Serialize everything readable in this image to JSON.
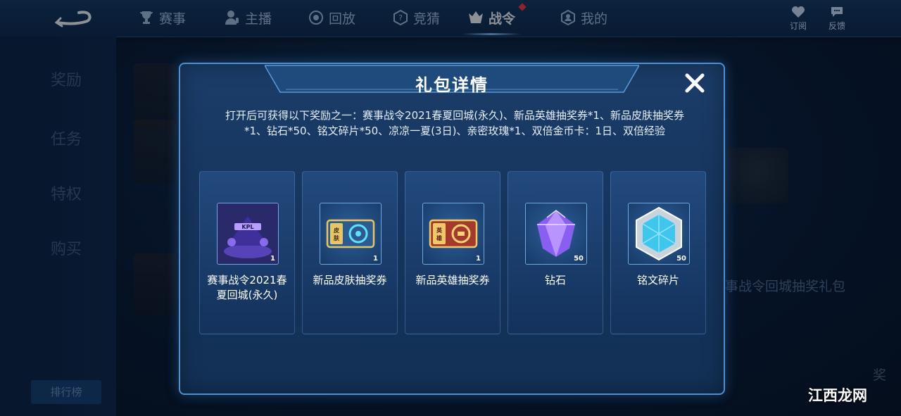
{
  "nav": {
    "items": [
      {
        "label": "赛事",
        "icon": "trophy-icon"
      },
      {
        "label": "主播",
        "icon": "streamer-icon"
      },
      {
        "label": "回放",
        "icon": "replay-icon"
      },
      {
        "label": "竞猜",
        "icon": "quiz-icon"
      },
      {
        "label": "战令",
        "icon": "battlepass-icon",
        "active": true
      },
      {
        "label": "我的",
        "icon": "profile-icon"
      }
    ],
    "subscribe_label": "订阅",
    "feedback_label": "反馈"
  },
  "background": {
    "side_tabs": [
      "奖励",
      "任务",
      "特权",
      "购买"
    ],
    "rank_button": "排行榜",
    "right_title": "事战令回城抽奖礼包",
    "reward_label": "奖"
  },
  "modal": {
    "title": "礼包详情",
    "description": "打开后可获得以下奖励之一：赛事战令2021春夏回城(永久)、新品英雄抽奖券*1、新品皮肤抽奖券*1、钻石*50、铭文碎片*50、凉凉一夏(3日)、亲密玫瑰*1、双倍金币卡：1日、双倍经验",
    "items": [
      {
        "name": "赛事战令2021春夏回城(永久)",
        "qty": "1",
        "icon": "recall-effect-icon"
      },
      {
        "name": "新品皮肤抽奖券",
        "qty": "1",
        "icon": "skin-ticket-icon"
      },
      {
        "name": "新品英雄抽奖券",
        "qty": "1",
        "icon": "hero-ticket-icon"
      },
      {
        "name": "钻石",
        "qty": "50",
        "icon": "diamond-icon"
      },
      {
        "name": "铭文碎片",
        "qty": "50",
        "icon": "inscription-shard-icon"
      }
    ]
  },
  "watermark": "江西龙网",
  "colors": {
    "accent": "#4d8fd1",
    "active_dot": "#ff3a3a"
  }
}
